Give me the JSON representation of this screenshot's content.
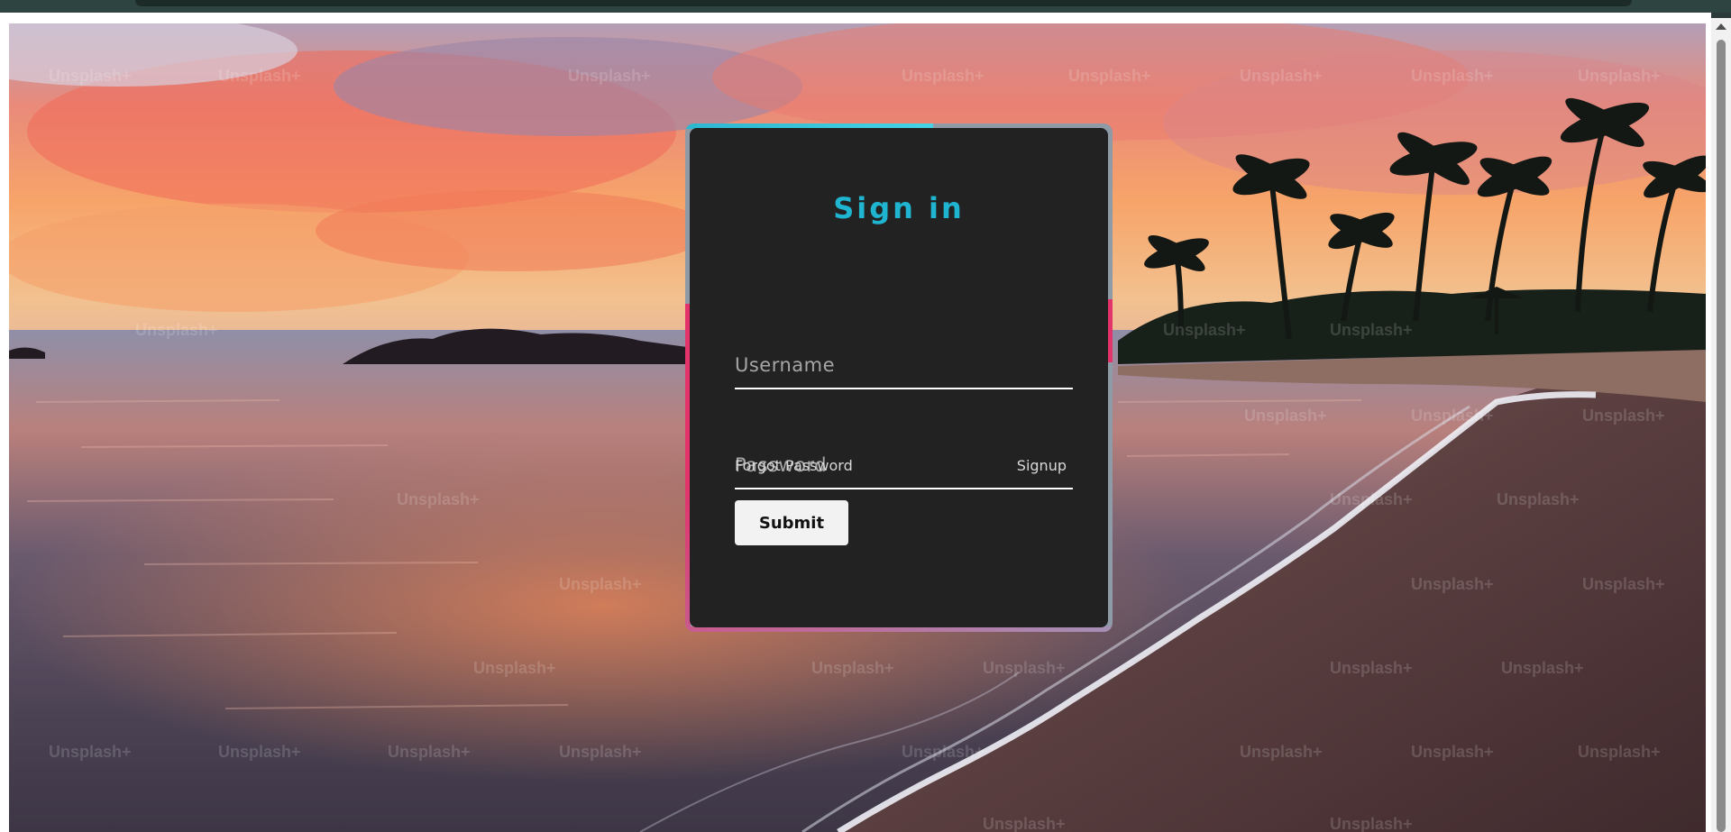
{
  "watermark": {
    "text": "Unsplash+"
  },
  "signin": {
    "title": "Sign in",
    "username_placeholder": "Username",
    "password_placeholder": "Password",
    "forgot_label": "Forgot Password",
    "signup_label": "Signup",
    "submit_label": "Submit"
  },
  "colors": {
    "accent": "#1fb5d1",
    "card_bg": "#222222",
    "edge_pink": "#e2336b",
    "edge_cyan": "#2bb7d0"
  }
}
